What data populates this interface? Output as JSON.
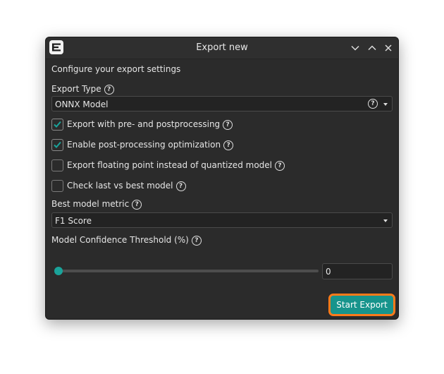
{
  "window": {
    "title": "Export new"
  },
  "dialog": {
    "intro": "Configure your export settings",
    "export_type": {
      "label": "Export Type",
      "selected": "ONNX Model"
    },
    "checkboxes": [
      {
        "label": "Export with pre- and postprocessing",
        "checked": true
      },
      {
        "label": "Enable post-processing optimization",
        "checked": true
      },
      {
        "label": "Export floating point instead of quantized model",
        "checked": false
      },
      {
        "label": "Check last vs best model",
        "checked": false
      }
    ],
    "best_metric": {
      "label": "Best model metric",
      "selected": "F1 Score"
    },
    "confidence": {
      "label": "Model Confidence Threshold (%)",
      "value": "0",
      "slider_fraction": 0
    },
    "start_button": "Start Export"
  },
  "colors": {
    "accent": "#17948c",
    "highlight": "#ff7a1a",
    "window_bg": "#2b2b2b"
  }
}
